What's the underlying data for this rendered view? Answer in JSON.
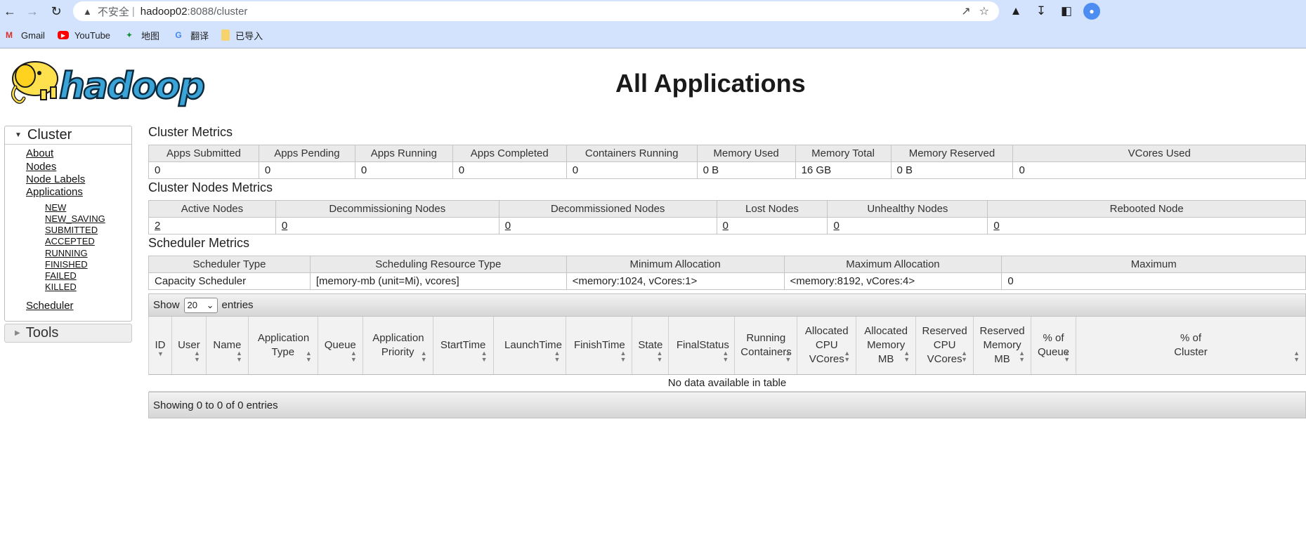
{
  "browser": {
    "address": {
      "security_label": "不安全",
      "separator": "|",
      "host": "hadoop02",
      "path": ":8088/cluster"
    },
    "bookmarks": [
      {
        "label": "Gmail",
        "icon": "gmail-icon"
      },
      {
        "label": "YouTube",
        "icon": "youtube-icon"
      },
      {
        "label": "地图",
        "icon": "maps-icon"
      },
      {
        "label": "翻译",
        "icon": "translate-icon"
      },
      {
        "label": "已导入",
        "icon": "folder-icon"
      }
    ]
  },
  "page": {
    "title": "All Applications"
  },
  "nav": {
    "cluster_label": "Cluster",
    "links": [
      "About",
      "Nodes",
      "Node Labels",
      "Applications"
    ],
    "app_states": [
      "NEW",
      "NEW_SAVING",
      "SUBMITTED",
      "ACCEPTED",
      "RUNNING",
      "FINISHED",
      "FAILED",
      "KILLED"
    ],
    "scheduler_label": "Scheduler",
    "tools_label": "Tools"
  },
  "cluster_metrics": {
    "title": "Cluster Metrics",
    "headers": [
      "Apps Submitted",
      "Apps Pending",
      "Apps Running",
      "Apps Completed",
      "Containers Running",
      "Memory Used",
      "Memory Total",
      "Memory Reserved",
      "VCores Used"
    ],
    "values": [
      "0",
      "0",
      "0",
      "0",
      "0",
      "0 B",
      "16 GB",
      "0 B",
      "0"
    ]
  },
  "nodes_metrics": {
    "title": "Cluster Nodes Metrics",
    "headers": [
      "Active Nodes",
      "Decommissioning Nodes",
      "Decommissioned Nodes",
      "Lost Nodes",
      "Unhealthy Nodes",
      "Rebooted Node"
    ],
    "values": [
      "2",
      "0",
      "0",
      "0",
      "0",
      "0"
    ]
  },
  "scheduler_metrics": {
    "title": "Scheduler Metrics",
    "headers": [
      "Scheduler Type",
      "Scheduling Resource Type",
      "Minimum Allocation",
      "Maximum Allocation",
      "Maximum"
    ],
    "values": [
      "Capacity Scheduler",
      "[memory-mb (unit=Mi), vcores]",
      "<memory:1024, vCores:1>",
      "<memory:8192, vCores:4>",
      "0"
    ]
  },
  "apps_table": {
    "show_label": "Show",
    "page_size": "20",
    "entries_label": "entries",
    "headers": [
      "ID",
      "User",
      "Name",
      "Application Type",
      "Queue",
      "Application Priority",
      "StartTime",
      "LaunchTime",
      "FinishTime",
      "State",
      "FinalStatus",
      "Running Containers",
      "Allocated CPU VCores",
      "Allocated Memory MB",
      "Reserved CPU VCores",
      "Reserved Memory MB",
      "% of Queue",
      "% of Cluster"
    ],
    "empty_message": "No data available in table",
    "footer": "Showing 0 to 0 of 0 entries"
  }
}
